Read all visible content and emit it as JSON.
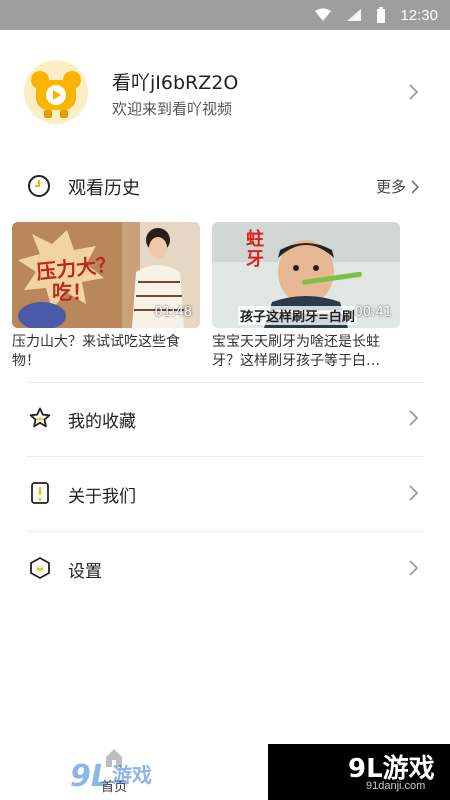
{
  "status_bar": {
    "time": "12:30",
    "icons": [
      "wifi-icon",
      "signal-icon",
      "battery-icon"
    ]
  },
  "profile": {
    "username": "看吖jI6bRZ2O",
    "subtitle": "欢迎来到看吖视频"
  },
  "history": {
    "title": "观看历史",
    "more_label": "更多",
    "videos": [
      {
        "title": "压力山大？来试试吃这些食物！",
        "duration": "01:48",
        "thumb_text_1": "压力大？",
        "thumb_text_2": "吃！"
      },
      {
        "title": "宝宝天天刷牙为啥还是长蛀牙？这样刷牙孩子等于白…",
        "duration": "00:41",
        "thumb_text_1": "蛀牙",
        "thumb_text_2": "孩子这样刷牙=白刷"
      }
    ]
  },
  "menu": [
    {
      "label": "我的收藏",
      "icon": "star-icon"
    },
    {
      "label": "关于我们",
      "icon": "info-icon"
    },
    {
      "label": "设置",
      "icon": "hexagon-settings-icon"
    }
  ],
  "bottom_nav": {
    "home_label": "首页"
  },
  "watermark": {
    "brand": "9L游戏",
    "site": "91danji.com"
  },
  "colors": {
    "accent": "#f7b500",
    "status_bar": "#9e9e9e",
    "divider": "#ededed"
  }
}
